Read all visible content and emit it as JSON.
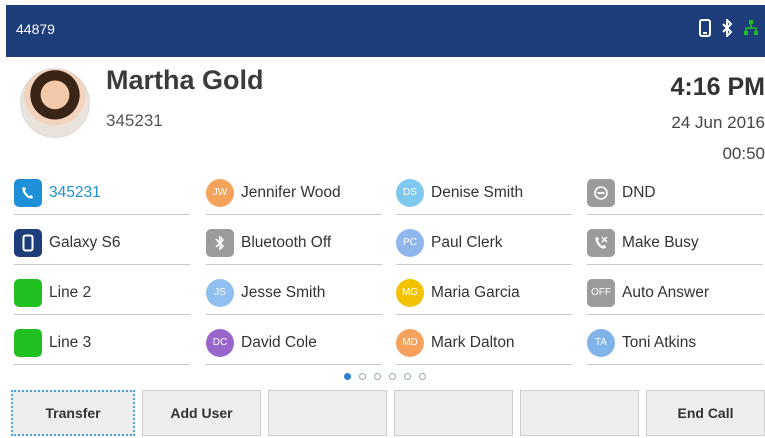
{
  "status": {
    "extension": "44879",
    "icons": [
      "phone-handset-icon",
      "bluetooth-icon",
      "network-icon"
    ]
  },
  "caller": {
    "name": "Martha Gold",
    "number": "345231",
    "time": "4:16 PM",
    "date": "24 Jun 2016",
    "duration": "00:50"
  },
  "keys": [
    {
      "label": "345231",
      "icon": "phone-icon",
      "style": "sq",
      "color": "#1e90d8",
      "initials": "",
      "highlight": true
    },
    {
      "label": "Galaxy S6",
      "icon": "mobile-icon",
      "style": "sq",
      "color": "#1e3d7b",
      "initials": ""
    },
    {
      "label": "Line 2",
      "icon": "line-icon",
      "style": "sq",
      "color": "#22c122",
      "initials": ""
    },
    {
      "label": "Line 3",
      "icon": "line-icon",
      "style": "sq",
      "color": "#22c122",
      "initials": ""
    },
    {
      "label": "Jennifer Wood",
      "icon": "contact-avatar-icon",
      "style": "round",
      "color": "#f3a35b",
      "initials": "JW"
    },
    {
      "label": "Bluetooth Off",
      "icon": "bluetooth-icon",
      "style": "sq",
      "color": "#9b9b9b",
      "initials": ""
    },
    {
      "label": "Jesse Smith",
      "icon": "contact-avatar-icon",
      "style": "round",
      "color": "#8fc0ef",
      "initials": "JS"
    },
    {
      "label": "David Cole",
      "icon": "contact-avatar-icon",
      "style": "round",
      "color": "#9966cc",
      "initials": "DC"
    },
    {
      "label": "Denise Smith",
      "icon": "contact-avatar-icon",
      "style": "round",
      "color": "#7fc8f0",
      "initials": "DS"
    },
    {
      "label": "Paul Clerk",
      "icon": "contact-avatar-icon",
      "style": "round",
      "color": "#8fb7ee",
      "initials": "PC"
    },
    {
      "label": "Maria Garcia",
      "icon": "contact-avatar-icon",
      "style": "round",
      "color": "#f2c200",
      "initials": "MG"
    },
    {
      "label": "Mark Dalton",
      "icon": "contact-avatar-icon",
      "style": "round",
      "color": "#f6a25e",
      "initials": "MD"
    },
    {
      "label": "DND",
      "icon": "dnd-icon",
      "style": "sq",
      "color": "#9b9b9b",
      "initials": ""
    },
    {
      "label": "Make Busy",
      "icon": "make-busy-icon",
      "style": "sq",
      "color": "#9b9b9b",
      "initials": ""
    },
    {
      "label": "Auto Answer",
      "icon": "auto-answer-icon",
      "style": "sq",
      "color": "#9b9b9b",
      "initials": "OFF"
    },
    {
      "label": "Toni Atkins",
      "icon": "contact-avatar-icon",
      "style": "round",
      "color": "#7fb3ea",
      "initials": "TA"
    }
  ],
  "pager": {
    "pages": 6,
    "active": 1
  },
  "softkeys": [
    {
      "label": "Transfer"
    },
    {
      "label": "Add User"
    },
    {
      "label": ""
    },
    {
      "label": ""
    },
    {
      "label": ""
    },
    {
      "label": "End Call"
    }
  ],
  "colors": {
    "statusbar": "#1e3d7b",
    "accent": "#1e90d8"
  }
}
